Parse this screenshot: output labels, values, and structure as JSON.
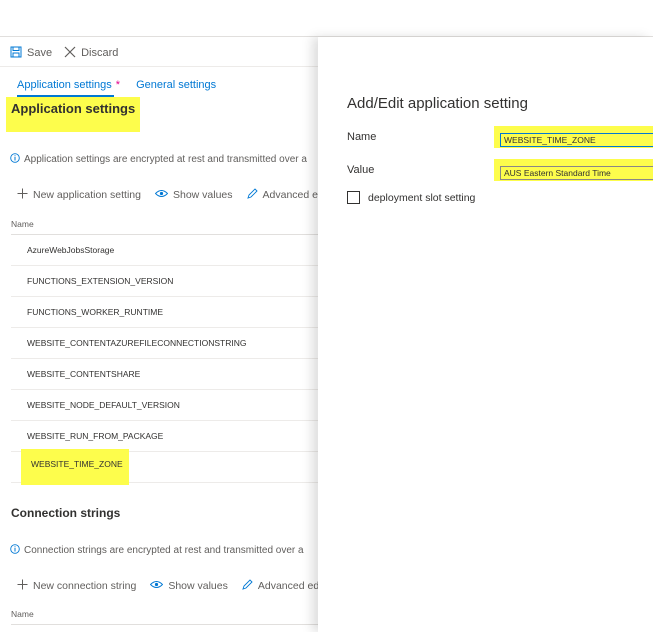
{
  "toolbar": {
    "save_label": "Save",
    "discard_label": "Discard"
  },
  "tabs": [
    {
      "label": "Application settings",
      "modified_marker": "*"
    },
    {
      "label": "General settings"
    }
  ],
  "app_settings": {
    "title": "Application settings",
    "info_text": "Application settings are encrypted at rest and transmitted over a",
    "actions": {
      "new_label": "New application setting",
      "show_values_label": "Show values",
      "advanced_label": "Advanced edit"
    },
    "column_name": "Name",
    "rows": [
      "AzureWebJobsStorage",
      "FUNCTIONS_EXTENSION_VERSION",
      "FUNCTIONS_WORKER_RUNTIME",
      "WEBSITE_CONTENTAZUREFILECONNECTIONSTRING",
      "WEBSITE_CONTENTSHARE",
      "WEBSITE_NODE_DEFAULT_VERSION",
      "WEBSITE_RUN_FROM_PACKAGE",
      "WEBSITE_TIME_ZONE"
    ]
  },
  "connection_strings": {
    "title": "Connection strings",
    "info_text": "Connection strings are encrypted at rest and transmitted over a",
    "actions": {
      "new_label": "New connection string",
      "show_values_label": "Show values",
      "advanced_label": "Advanced edit"
    },
    "column_name": "Name"
  },
  "panel": {
    "title": "Add/Edit application setting",
    "name_label": "Name",
    "name_value": "WEBSITE_TIME_ZONE",
    "value_label": "Value",
    "value_value": "AUS Eastern Standard Time",
    "slot_label": "deployment slot setting",
    "slot_checked": false
  },
  "colors": {
    "accent": "#0078d4",
    "highlight": "#fdfd4c",
    "modified": "#e3008c"
  }
}
